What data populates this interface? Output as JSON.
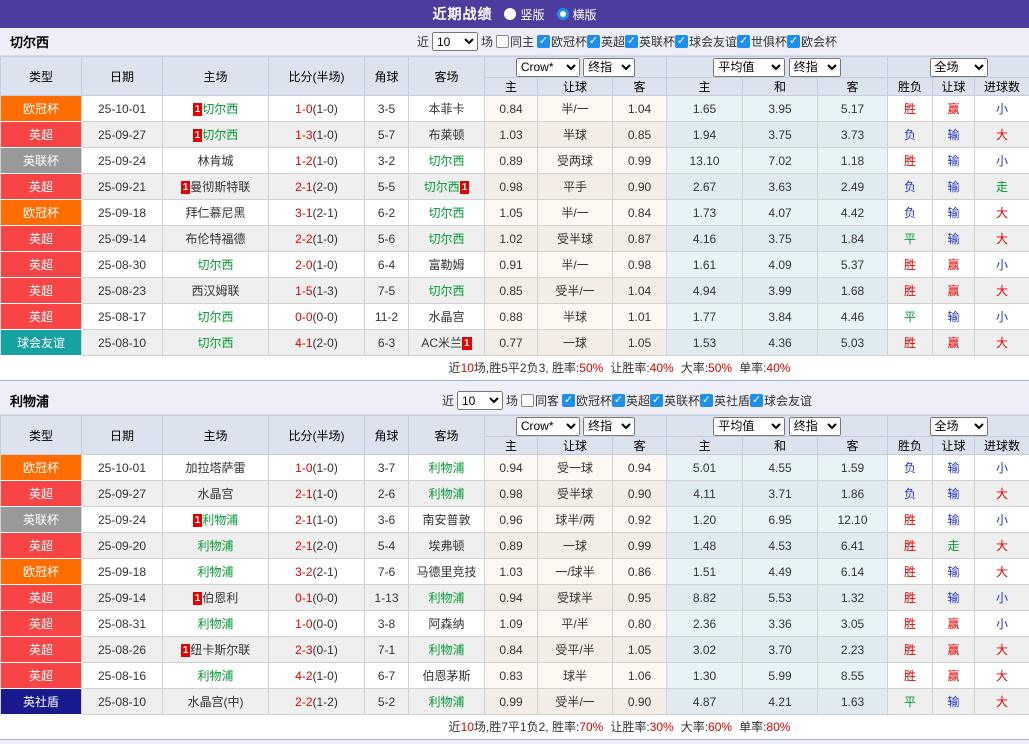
{
  "topbar": {
    "title": "近期战绩",
    "vertical_label": "竖版",
    "horizontal_label": "横版"
  },
  "filter_common": {
    "near_label": "近",
    "games_count": "10",
    "games_label": "场"
  },
  "columns": {
    "main": [
      "类型",
      "日期",
      "主场",
      "比分(半场)",
      "角球",
      "客场"
    ],
    "sub": [
      "主",
      "让球",
      "客",
      "主",
      "和",
      "客",
      "胜负",
      "让球",
      "进球数"
    ],
    "dropdowns": {
      "provider": "Crow*",
      "final": "终指",
      "average": "平均值",
      "scope": "全场"
    }
  },
  "type_colors": {
    "欧冠杯": "#ff6c00",
    "英超": "#f84444",
    "英联杯": "#999999",
    "球会友谊": "#17a2a2",
    "英社盾": "#19198f"
  },
  "result_colors": {
    "胜": "#e60000",
    "平": "#009933",
    "负": "#2233cc",
    "赢": "#e60000",
    "输": "#2233cc",
    "走": "#009933",
    "大": "#e60000",
    "小": "#2233cc"
  },
  "sections": [
    {
      "team": "切尔西",
      "filter": {
        "same_label": "同主",
        "leagues": [
          "欧冠杯",
          "英超",
          "英联杯",
          "球会友谊",
          "世俱杯",
          "欧会杯"
        ]
      },
      "rows": [
        {
          "type": "欧冠杯",
          "date": "25-10-01",
          "home": "切尔西",
          "home_badge": "1",
          "home_green": true,
          "score": "1-0",
          "half": "(1-0)",
          "corner": "3-5",
          "away": "本菲卡",
          "away_badge": "",
          "away_green": false,
          "odds": [
            "0.84",
            "半/一",
            "1.04"
          ],
          "avg": [
            "1.65",
            "3.95",
            "5.17"
          ],
          "results": [
            "胜",
            "赢",
            "小"
          ]
        },
        {
          "type": "英超",
          "date": "25-09-27",
          "home": "切尔西",
          "home_badge": "1",
          "home_green": true,
          "score": "1-3",
          "half": "(1-0)",
          "corner": "5-7",
          "away": "布莱顿",
          "away_badge": "",
          "away_green": false,
          "odds": [
            "1.03",
            "半球",
            "0.85"
          ],
          "avg": [
            "1.94",
            "3.75",
            "3.73"
          ],
          "results": [
            "负",
            "输",
            "大"
          ]
        },
        {
          "type": "英联杯",
          "date": "25-09-24",
          "home": "林肯城",
          "home_badge": "",
          "home_green": false,
          "score": "1-2",
          "half": "(1-0)",
          "corner": "3-2",
          "away": "切尔西",
          "away_badge": "",
          "away_green": true,
          "odds": [
            "0.89",
            "受两球",
            "0.99"
          ],
          "avg": [
            "13.10",
            "7.02",
            "1.18"
          ],
          "results": [
            "胜",
            "输",
            "小"
          ]
        },
        {
          "type": "英超",
          "date": "25-09-21",
          "home": "曼彻斯特联",
          "home_badge": "1",
          "home_green": false,
          "score": "2-1",
          "half": "(2-0)",
          "corner": "5-5",
          "away": "切尔西",
          "away_badge": "1",
          "away_green": true,
          "odds": [
            "0.98",
            "平手",
            "0.90"
          ],
          "avg": [
            "2.67",
            "3.63",
            "2.49"
          ],
          "results": [
            "负",
            "输",
            "走"
          ]
        },
        {
          "type": "欧冠杯",
          "date": "25-09-18",
          "home": "拜仁慕尼黑",
          "home_badge": "",
          "home_green": false,
          "score": "3-1",
          "half": "(2-1)",
          "corner": "6-2",
          "away": "切尔西",
          "away_badge": "",
          "away_green": true,
          "odds": [
            "1.05",
            "半/一",
            "0.84"
          ],
          "avg": [
            "1.73",
            "4.07",
            "4.42"
          ],
          "results": [
            "负",
            "输",
            "大"
          ]
        },
        {
          "type": "英超",
          "date": "25-09-14",
          "home": "布伦特福德",
          "home_badge": "",
          "home_green": false,
          "score": "2-2",
          "half": "(1-0)",
          "corner": "5-6",
          "away": "切尔西",
          "away_badge": "",
          "away_green": true,
          "odds": [
            "1.02",
            "受半球",
            "0.87"
          ],
          "avg": [
            "4.16",
            "3.75",
            "1.84"
          ],
          "results": [
            "平",
            "输",
            "大"
          ]
        },
        {
          "type": "英超",
          "date": "25-08-30",
          "home": "切尔西",
          "home_badge": "",
          "home_green": true,
          "score": "2-0",
          "half": "(1-0)",
          "corner": "6-4",
          "away": "富勒姆",
          "away_badge": "",
          "away_green": false,
          "odds": [
            "0.91",
            "半/一",
            "0.98"
          ],
          "avg": [
            "1.61",
            "4.09",
            "5.37"
          ],
          "results": [
            "胜",
            "赢",
            "小"
          ]
        },
        {
          "type": "英超",
          "date": "25-08-23",
          "home": "西汉姆联",
          "home_badge": "",
          "home_green": false,
          "score": "1-5",
          "half": "(1-3)",
          "corner": "7-5",
          "away": "切尔西",
          "away_badge": "",
          "away_green": true,
          "odds": [
            "0.85",
            "受半/一",
            "1.04"
          ],
          "avg": [
            "4.94",
            "3.99",
            "1.68"
          ],
          "results": [
            "胜",
            "赢",
            "大"
          ]
        },
        {
          "type": "英超",
          "date": "25-08-17",
          "home": "切尔西",
          "home_badge": "",
          "home_green": true,
          "score": "0-0",
          "half": "(0-0)",
          "corner": "11-2",
          "away": "水晶宫",
          "away_badge": "",
          "away_green": false,
          "odds": [
            "0.88",
            "半球",
            "1.01"
          ],
          "avg": [
            "1.77",
            "3.84",
            "4.46"
          ],
          "results": [
            "平",
            "输",
            "小"
          ]
        },
        {
          "type": "球会友谊",
          "date": "25-08-10",
          "home": "切尔西",
          "home_badge": "",
          "home_green": true,
          "score": "4-1",
          "half": "(2-0)",
          "corner": "6-3",
          "away": "AC米兰",
          "away_badge": "1",
          "away_green": false,
          "odds": [
            "0.77",
            "一球",
            "1.05"
          ],
          "avg": [
            "1.53",
            "4.36",
            "5.03"
          ],
          "results": [
            "胜",
            "赢",
            "大"
          ]
        }
      ],
      "summary": {
        "near_label": "近",
        "count": "10",
        "record": "场,胜5平2负3, 胜率:",
        "win_rate": "50%",
        "handicap_label": "让胜率:",
        "handicap_rate": "40%",
        "big_label": "大率:",
        "big_rate": "50%",
        "single_label": "单率:",
        "single_rate": "40%"
      }
    },
    {
      "team": "利物浦",
      "filter": {
        "same_label": "同客",
        "leagues": [
          "欧冠杯",
          "英超",
          "英联杯",
          "英社盾",
          "球会友谊"
        ]
      },
      "rows": [
        {
          "type": "欧冠杯",
          "date": "25-10-01",
          "home": "加拉塔萨雷",
          "home_badge": "",
          "home_green": false,
          "score": "1-0",
          "half": "(1-0)",
          "corner": "3-7",
          "away": "利物浦",
          "away_badge": "",
          "away_green": true,
          "odds": [
            "0.94",
            "受一球",
            "0.94"
          ],
          "avg": [
            "5.01",
            "4.55",
            "1.59"
          ],
          "results": [
            "负",
            "输",
            "小"
          ]
        },
        {
          "type": "英超",
          "date": "25-09-27",
          "home": "水晶宫",
          "home_badge": "",
          "home_green": false,
          "score": "2-1",
          "half": "(1-0)",
          "corner": "2-6",
          "away": "利物浦",
          "away_badge": "",
          "away_green": true,
          "odds": [
            "0.98",
            "受半球",
            "0.90"
          ],
          "avg": [
            "4.11",
            "3.71",
            "1.86"
          ],
          "results": [
            "负",
            "输",
            "大"
          ]
        },
        {
          "type": "英联杯",
          "date": "25-09-24",
          "home": "利物浦",
          "home_badge": "1",
          "home_green": true,
          "score": "2-1",
          "half": "(1-0)",
          "corner": "3-6",
          "away": "南安普敦",
          "away_badge": "",
          "away_green": false,
          "odds": [
            "0.96",
            "球半/两",
            "0.92"
          ],
          "avg": [
            "1.20",
            "6.95",
            "12.10"
          ],
          "results": [
            "胜",
            "输",
            "小"
          ]
        },
        {
          "type": "英超",
          "date": "25-09-20",
          "home": "利物浦",
          "home_badge": "",
          "home_green": true,
          "score": "2-1",
          "half": "(2-0)",
          "corner": "5-4",
          "away": "埃弗顿",
          "away_badge": "",
          "away_green": false,
          "odds": [
            "0.89",
            "一球",
            "0.99"
          ],
          "avg": [
            "1.48",
            "4.53",
            "6.41"
          ],
          "results": [
            "胜",
            "走",
            "大"
          ]
        },
        {
          "type": "欧冠杯",
          "date": "25-09-18",
          "home": "利物浦",
          "home_badge": "",
          "home_green": true,
          "score": "3-2",
          "half": "(2-1)",
          "corner": "7-6",
          "away": "马德里竞技",
          "away_badge": "",
          "away_green": false,
          "odds": [
            "1.03",
            "一/球半",
            "0.86"
          ],
          "avg": [
            "1.51",
            "4.49",
            "6.14"
          ],
          "results": [
            "胜",
            "输",
            "大"
          ]
        },
        {
          "type": "英超",
          "date": "25-09-14",
          "home": "伯恩利",
          "home_badge": "1",
          "home_green": false,
          "score": "0-1",
          "half": "(0-0)",
          "corner": "1-13",
          "away": "利物浦",
          "away_badge": "",
          "away_green": true,
          "odds": [
            "0.94",
            "受球半",
            "0.95"
          ],
          "avg": [
            "8.82",
            "5.53",
            "1.32"
          ],
          "results": [
            "胜",
            "输",
            "小"
          ]
        },
        {
          "type": "英超",
          "date": "25-08-31",
          "home": "利物浦",
          "home_badge": "",
          "home_green": true,
          "score": "1-0",
          "half": "(0-0)",
          "corner": "3-8",
          "away": "阿森纳",
          "away_badge": "",
          "away_green": false,
          "odds": [
            "1.09",
            "平/半",
            "0.80"
          ],
          "avg": [
            "2.36",
            "3.36",
            "3.05"
          ],
          "results": [
            "胜",
            "赢",
            "小"
          ]
        },
        {
          "type": "英超",
          "date": "25-08-26",
          "home": "纽卡斯尔联",
          "home_badge": "1",
          "home_green": false,
          "score": "2-3",
          "half": "(0-1)",
          "corner": "7-1",
          "away": "利物浦",
          "away_badge": "",
          "away_green": true,
          "odds": [
            "0.84",
            "受平/半",
            "1.05"
          ],
          "avg": [
            "3.02",
            "3.70",
            "2.23"
          ],
          "results": [
            "胜",
            "赢",
            "大"
          ]
        },
        {
          "type": "英超",
          "date": "25-08-16",
          "home": "利物浦",
          "home_badge": "",
          "home_green": true,
          "score": "4-2",
          "half": "(1-0)",
          "corner": "6-7",
          "away": "伯恩茅斯",
          "away_badge": "",
          "away_green": false,
          "odds": [
            "0.83",
            "球半",
            "1.06"
          ],
          "avg": [
            "1.30",
            "5.99",
            "8.55"
          ],
          "results": [
            "胜",
            "赢",
            "大"
          ]
        },
        {
          "type": "英社盾",
          "date": "25-08-10",
          "home": "水晶宫(中)",
          "home_badge": "",
          "home_green": false,
          "score": "2-2",
          "half": "(1-2)",
          "corner": "5-2",
          "away": "利物浦",
          "away_badge": "",
          "away_green": true,
          "odds": [
            "0.99",
            "受半/一",
            "0.90"
          ],
          "avg": [
            "4.87",
            "4.21",
            "1.63"
          ],
          "results": [
            "平",
            "输",
            "大"
          ]
        }
      ],
      "summary": {
        "near_label": "近",
        "count": "10",
        "record": "场,胜7平1负2, 胜率:",
        "win_rate": "70%",
        "handicap_label": "让胜率:",
        "handicap_rate": "30%",
        "big_label": "大率:",
        "big_rate": "60%",
        "single_label": "单率:",
        "single_rate": "80%"
      }
    }
  ]
}
